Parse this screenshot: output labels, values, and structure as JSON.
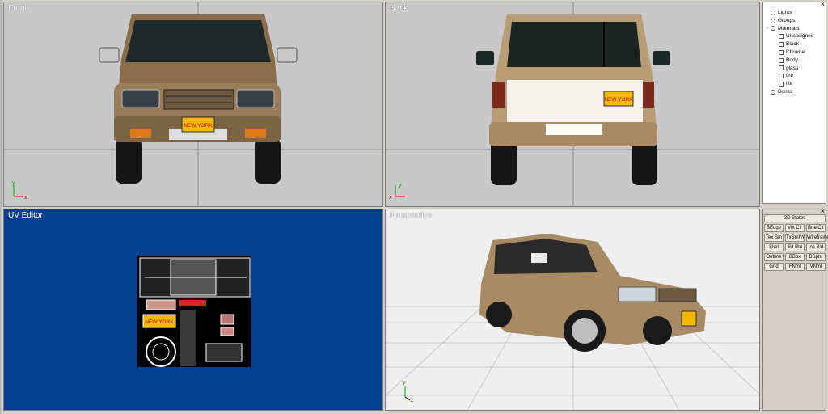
{
  "viewports": {
    "front": {
      "title": "Front",
      "plate": "NEW YORK",
      "axis_x": "x",
      "axis_y": "y"
    },
    "back": {
      "title": "Back",
      "plate": "NEW YORK",
      "axis_x": "x",
      "axis_y": "y"
    },
    "uv": {
      "title": "UV Editor",
      "plate": "NEW YORK"
    },
    "perspective": {
      "title": "Perspective",
      "axis_y": "y",
      "axis_z": "z"
    }
  },
  "tree": {
    "items": [
      {
        "label": "Lights",
        "icon": "light-icon",
        "level": 0,
        "expander": ""
      },
      {
        "label": "Groups",
        "icon": "group-icon",
        "level": 0,
        "expander": ""
      },
      {
        "label": "Materials",
        "icon": "material-icon",
        "level": 0,
        "expander": "−"
      },
      {
        "label": "Unassigned",
        "icon": "material-swatch-icon",
        "level": 1
      },
      {
        "label": "Black",
        "icon": "material-swatch-icon",
        "level": 1
      },
      {
        "label": "Chrome",
        "icon": "material-swatch-icon",
        "level": 1
      },
      {
        "label": "Body",
        "icon": "material-swatch-icon",
        "level": 1
      },
      {
        "label": "glass",
        "icon": "material-swatch-icon",
        "level": 1
      },
      {
        "label": "tire",
        "icon": "material-swatch-icon",
        "level": 1
      },
      {
        "label": "lite",
        "icon": "material-swatch-icon",
        "level": 1
      },
      {
        "label": "Bones",
        "icon": "bone-icon",
        "level": 0,
        "expander": ""
      }
    ]
  },
  "states": {
    "header": "3D States",
    "buttons": [
      "BEdge",
      "Vtx Clr",
      "Bne Clr",
      "Tex Sm",
      "TxSmlVr",
      "Wireframe",
      "Skel",
      "Sd Bld",
      "Inc Bld",
      "Outline",
      "BBox",
      "BSphr",
      "Grid",
      "FNml",
      "VNml"
    ]
  },
  "colors": {
    "body": "#a88a64",
    "uv_bg": "#073f8f",
    "viewport_bg": "#c8c8c8",
    "plate": "#f5b800"
  }
}
